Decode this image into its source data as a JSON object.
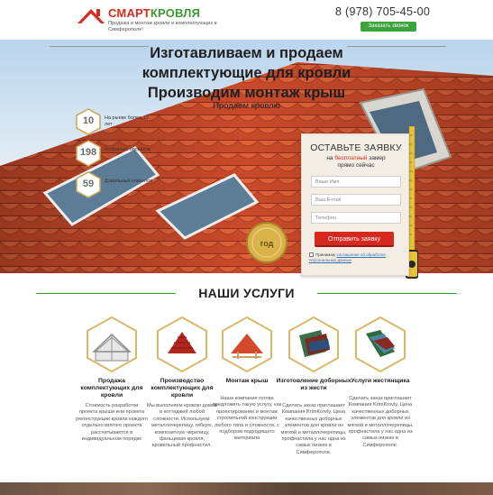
{
  "header": {
    "logo_part1": "СМАРТ",
    "logo_part2": "КРОВЛЯ",
    "logo_sub": "Продажа и монтаж кровли и комплектующих в Симферополе!",
    "phone": "8 (978) 705-45-00",
    "call_button": "Заказать звонок"
  },
  "hero": {
    "line1": "Изготавливаем и продаем",
    "line2": "комплектующие для кровли",
    "line3": "Производим монтаж крыш",
    "sub": "Продаем кровлю",
    "stats": [
      {
        "num": "10",
        "label": "На рынке более 10 лет"
      },
      {
        "num": "198",
        "label": "Успешных проектов"
      },
      {
        "num": "59",
        "label": "Довольных клиентов"
      }
    ],
    "seal_text": "год"
  },
  "form": {
    "title": "ОСТАВЬТЕ ЗАЯВКУ",
    "sub_pre": "на",
    "sub_hl": "бесплатный",
    "sub_post": "замер",
    "sub_line2": "прямо сейчас",
    "name_placeholder": "Ваше Имя",
    "email_placeholder": "Ваш E-mail",
    "phone_placeholder": "Телефон",
    "submit": "Отправить заявку",
    "agree_text": "Принимаю",
    "agree_link": "соглашение об обработке персональных данных"
  },
  "services": {
    "title": "НАШИ УСЛУГИ",
    "items": [
      {
        "name": "Продажа комплектующих для кровли",
        "desc": "Стоимость разработки проекта крыши или проекта реконструкции кровли каждого отдельно взятого проекта рассчитывается в индивидуальном порядке"
      },
      {
        "name": "Производство комплектующих для кровли",
        "desc": "Мы выполняем кровлю домов и коттеджей любой сложности. Используем: металлочерепицу, гибкую, композитную черепицу, фальцевая кровля, кровельный профнастил."
      },
      {
        "name": "Монтаж крыш",
        "desc": "Наша компания готова предложить такую услугу, как проектирование и монтаж стропильной конструкции любого типа и сложности, с подбором подходящего материала"
      },
      {
        "name": "Изготовление доборных из жести",
        "desc": "Сделать заказ приглашает Компания KrimKrovly. Цена качественных доборных элементов для кровли из мягкой и металлочерепицы, профнастила у нас одна из самых низких в Симферополе."
      },
      {
        "name": "Услуги жестянщика",
        "desc": "Сделать заказ приглашает Компания KrimKrovly. Цена качественных доборных элементов для кровли из мягкой и металлочерепицы, профнастила у нас одна из самых низких в Симферополе."
      }
    ]
  },
  "colors": {
    "accent_red": "#d62b1f",
    "accent_green": "#3a9a2e"
  }
}
